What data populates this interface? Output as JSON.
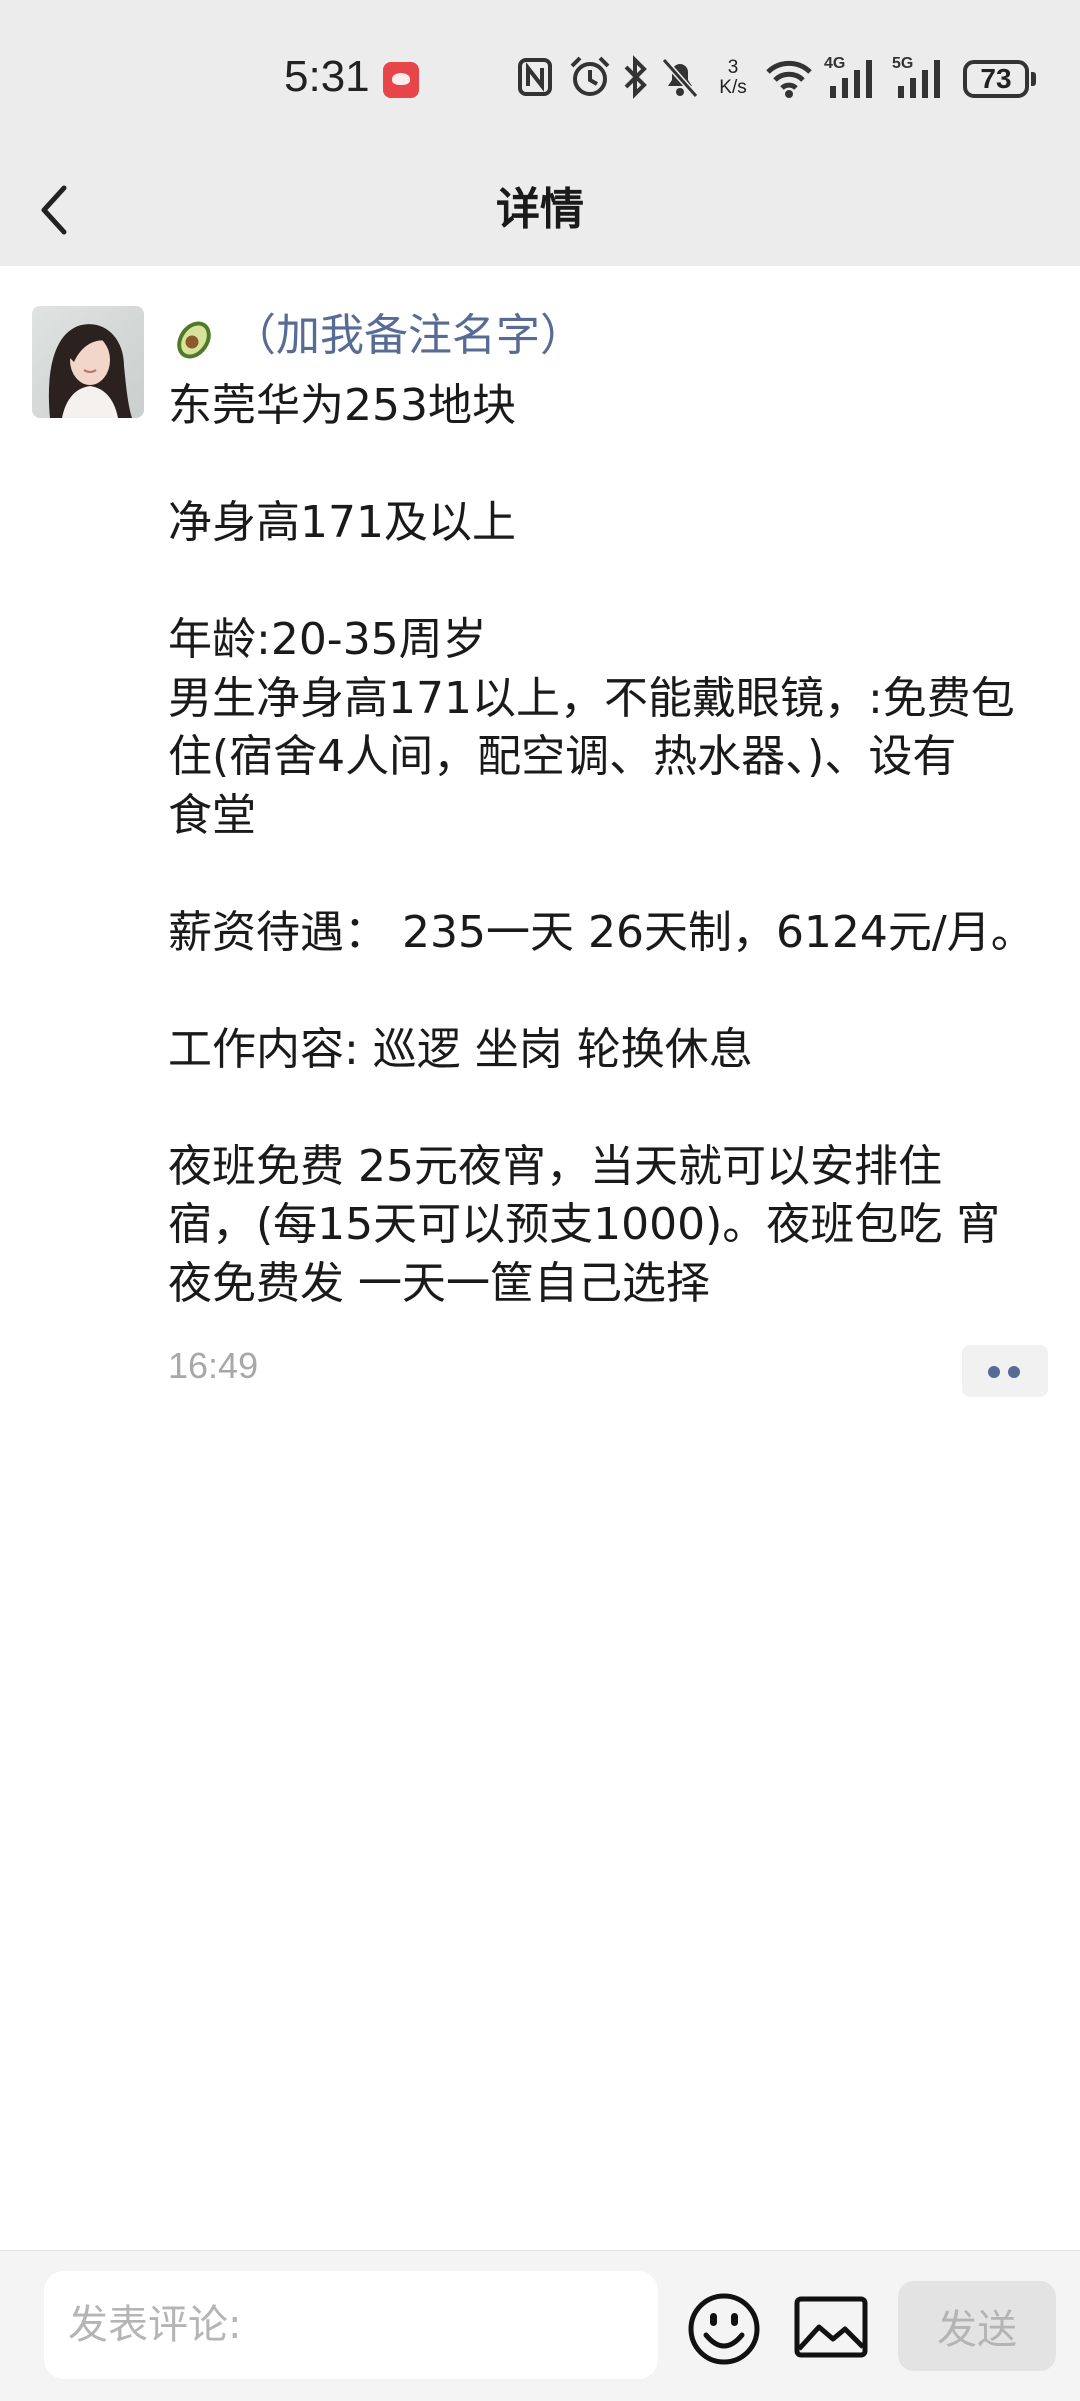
{
  "status_bar": {
    "time": "5:31",
    "net_speed_value": "3",
    "net_speed_unit": "K/s",
    "battery": "73",
    "icons": [
      "huawei-badge-icon",
      "nfc-icon",
      "alarm-icon",
      "bluetooth-icon",
      "mute-bell-icon",
      "wifi-icon",
      "signal-4g-icon",
      "signal-5g-icon",
      "battery-icon"
    ]
  },
  "nav": {
    "title": "详情",
    "back_icon": "chevron-left-icon"
  },
  "post": {
    "username": "（加我备注名字）",
    "lines": [
      "东莞华为253地块",
      "",
      "净身高171及以上",
      "",
      "年龄:20-35周岁",
      "男生净身高171以上，不能戴眼镜，:免费包",
      "住(宿舍4人间，配空调、热水器、)、设有",
      "食堂",
      "",
      "薪资待遇： 235一天 26天制，6124元/月。",
      "",
      "工作内容: 巡逻 坐岗 轮换休息",
      "",
      "夜班免费 25元夜宵，当天就可以安排住",
      "宿，(每15天可以预支1000)。夜班包吃 宵",
      "夜免费发 一天一筐自己选择"
    ],
    "time": "16:49"
  },
  "comment_bar": {
    "placeholder": "发表评论:",
    "send_label": "发送"
  },
  "colors": {
    "link_blue": "#576b95",
    "header_bg": "#ececec",
    "time_gray": "#a8a8a8"
  }
}
